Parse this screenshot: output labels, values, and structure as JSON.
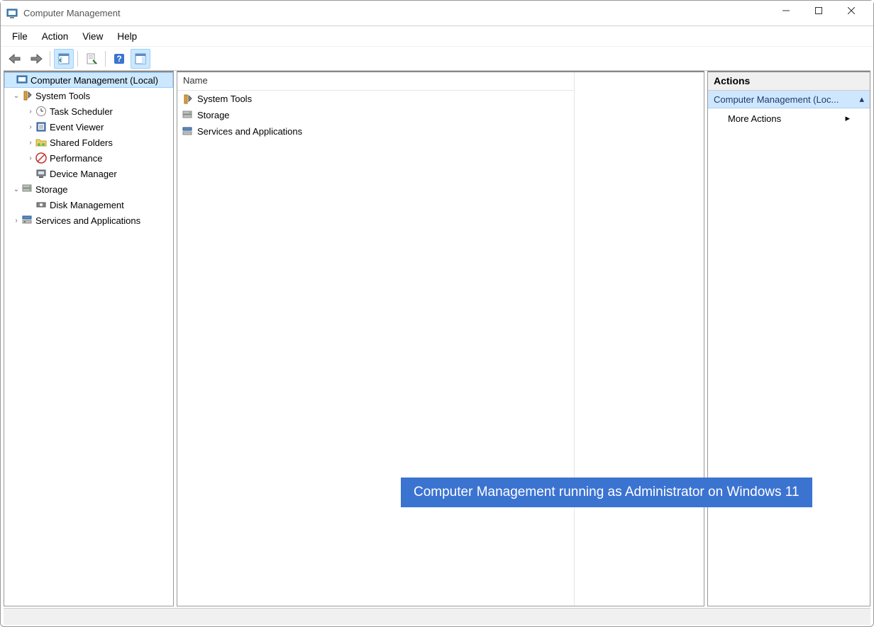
{
  "window": {
    "title": "Computer Management"
  },
  "menu": {
    "items": [
      "File",
      "Action",
      "View",
      "Help"
    ]
  },
  "tree": {
    "root": {
      "label": "Computer Management (Local)",
      "children": [
        {
          "label": "System Tools",
          "expanded": true,
          "children": [
            {
              "label": "Task Scheduler"
            },
            {
              "label": "Event Viewer"
            },
            {
              "label": "Shared Folders"
            },
            {
              "label": "Performance"
            },
            {
              "label": "Device Manager"
            }
          ]
        },
        {
          "label": "Storage",
          "expanded": true,
          "children": [
            {
              "label": "Disk Management"
            }
          ]
        },
        {
          "label": "Services and Applications",
          "expanded": false,
          "children": []
        }
      ]
    }
  },
  "list": {
    "header": "Name",
    "items": [
      {
        "label": "System Tools"
      },
      {
        "label": "Storage"
      },
      {
        "label": "Services and Applications"
      }
    ]
  },
  "actions": {
    "header": "Actions",
    "section": "Computer Management (Loc...",
    "items": [
      "More Actions"
    ]
  },
  "banner": "Computer Management running as Administrator on Windows 11"
}
